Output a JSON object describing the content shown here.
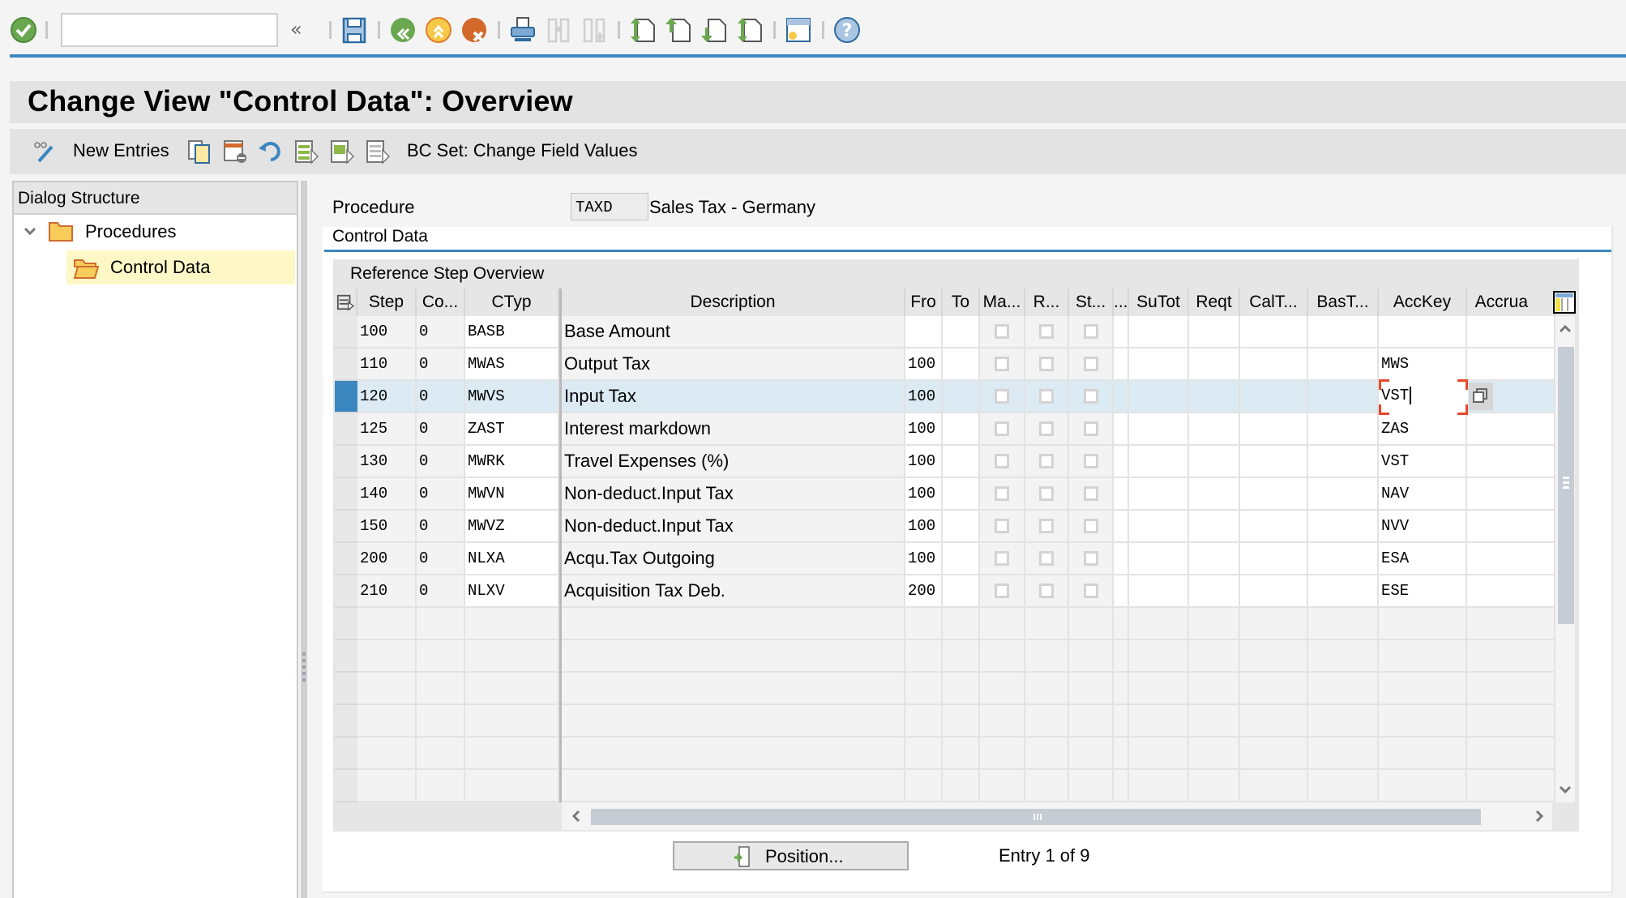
{
  "system_toolbar": {
    "command_field": {
      "value": "",
      "placeholder": ""
    },
    "icons": [
      "enter-check-icon",
      "command-collapse-icon",
      "save-icon",
      "back-icon",
      "exit-icon",
      "cancel-icon",
      "print-icon",
      "find-icon",
      "find-next-icon",
      "first-page-icon",
      "previous-page-icon",
      "next-page-icon",
      "last-page-icon",
      "customize-layout-icon",
      "help-icon"
    ],
    "collapse_glyph": "«"
  },
  "title": "Change View \"Control Data\": Overview",
  "app_toolbar": {
    "new_entries_label": "New Entries",
    "bc_set_label": "BC Set: Change Field Values"
  },
  "dialog_structure": {
    "header": "Dialog Structure",
    "items": [
      {
        "label": "Procedures",
        "expanded": true,
        "level": 0
      },
      {
        "label": "Control Data",
        "level": 1,
        "selected": true
      }
    ]
  },
  "procedure": {
    "label": "Procedure",
    "code": "TAXD",
    "description": "Sales Tax - Germany"
  },
  "tab": {
    "label": "Control Data"
  },
  "table": {
    "title": "Reference Step Overview",
    "columns": [
      "Step",
      "Co...",
      "CTyp",
      "Description",
      "Fro",
      "To",
      "Ma...",
      "R...",
      "St...",
      "...",
      "SuTot",
      "Reqt",
      "CalT...",
      "BasT...",
      "AccKey",
      "Accrua"
    ],
    "rows": [
      {
        "step": "100",
        "co": "0",
        "ctyp": "BASB",
        "description": "Base Amount",
        "fro": "",
        "to": "",
        "ma": false,
        "r": false,
        "st": false,
        "acckey": ""
      },
      {
        "step": "110",
        "co": "0",
        "ctyp": "MWAS",
        "description": "Output Tax",
        "fro": "100",
        "to": "",
        "ma": false,
        "r": false,
        "st": false,
        "acckey": "MWS"
      },
      {
        "step": "120",
        "co": "0",
        "ctyp": "MWVS",
        "description": "Input Tax",
        "fro": "100",
        "to": "",
        "ma": false,
        "r": false,
        "st": false,
        "acckey": "VST",
        "selected": true
      },
      {
        "step": "125",
        "co": "0",
        "ctyp": "ZAST",
        "description": "Interest markdown",
        "fro": "100",
        "to": "",
        "ma": false,
        "r": false,
        "st": false,
        "acckey": "ZAS"
      },
      {
        "step": "130",
        "co": "0",
        "ctyp": "MWRK",
        "description": "Travel Expenses (%)",
        "fro": "100",
        "to": "",
        "ma": false,
        "r": false,
        "st": false,
        "acckey": "VST"
      },
      {
        "step": "140",
        "co": "0",
        "ctyp": "MWVN",
        "description": "Non-deduct.Input Tax",
        "fro": "100",
        "to": "",
        "ma": false,
        "r": false,
        "st": false,
        "acckey": "NAV"
      },
      {
        "step": "150",
        "co": "0",
        "ctyp": "MWVZ",
        "description": "Non-deduct.Input Tax",
        "fro": "100",
        "to": "",
        "ma": false,
        "r": false,
        "st": false,
        "acckey": "NVV"
      },
      {
        "step": "200",
        "co": "0",
        "ctyp": "NLXA",
        "description": "Acqu.Tax Outgoing",
        "fro": "100",
        "to": "",
        "ma": false,
        "r": false,
        "st": false,
        "acckey": "ESA"
      },
      {
        "step": "210",
        "co": "0",
        "ctyp": "NLXV",
        "description": "Acquisition Tax Deb.",
        "fro": "200",
        "to": "",
        "ma": false,
        "r": false,
        "st": false,
        "acckey": "ESE"
      }
    ],
    "empty_rows": 6
  },
  "footer": {
    "position_button": "Position...",
    "entry_text": "Entry 1 of 9"
  },
  "colors": {
    "accent_blue": "#3a87c0",
    "selected_row": "#dceaf4",
    "selected_tree": "#fdf8c6",
    "focus_corner": "#e8472a"
  }
}
